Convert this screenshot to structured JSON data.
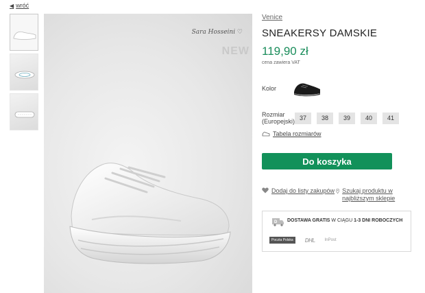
{
  "nav": {
    "back_label": "wróć"
  },
  "gallery": {
    "signature": "Sara Hosseini ♡",
    "badge": "NEW"
  },
  "product": {
    "brand": "Venice",
    "title": "SNEAKERSY DAMSKIE",
    "price": "119,90 zł",
    "vat_note": "cena zawiera VAT",
    "color_label": "Kolor",
    "size_label": "Rozmiar (Europejski)",
    "sizes": [
      "37",
      "38",
      "39",
      "40",
      "41"
    ],
    "size_table_label": "Tabela rozmiarów",
    "add_to_cart_label": "Do koszyka",
    "wishlist_label": "Dodaj do listy zakupów",
    "find_store_label": "Szukaj produktu w najbliższym sklepie"
  },
  "delivery": {
    "text_prefix": "DOSTAWA GRATIS",
    "text_middle": " W CIĄGU ",
    "text_bold": "1-3 DNI ROBOCZYCH",
    "carriers": [
      "Poczta Polska",
      "DHL",
      "InPost"
    ]
  },
  "colors": {
    "accent": "#12915a",
    "price": "#1a8d5b"
  }
}
